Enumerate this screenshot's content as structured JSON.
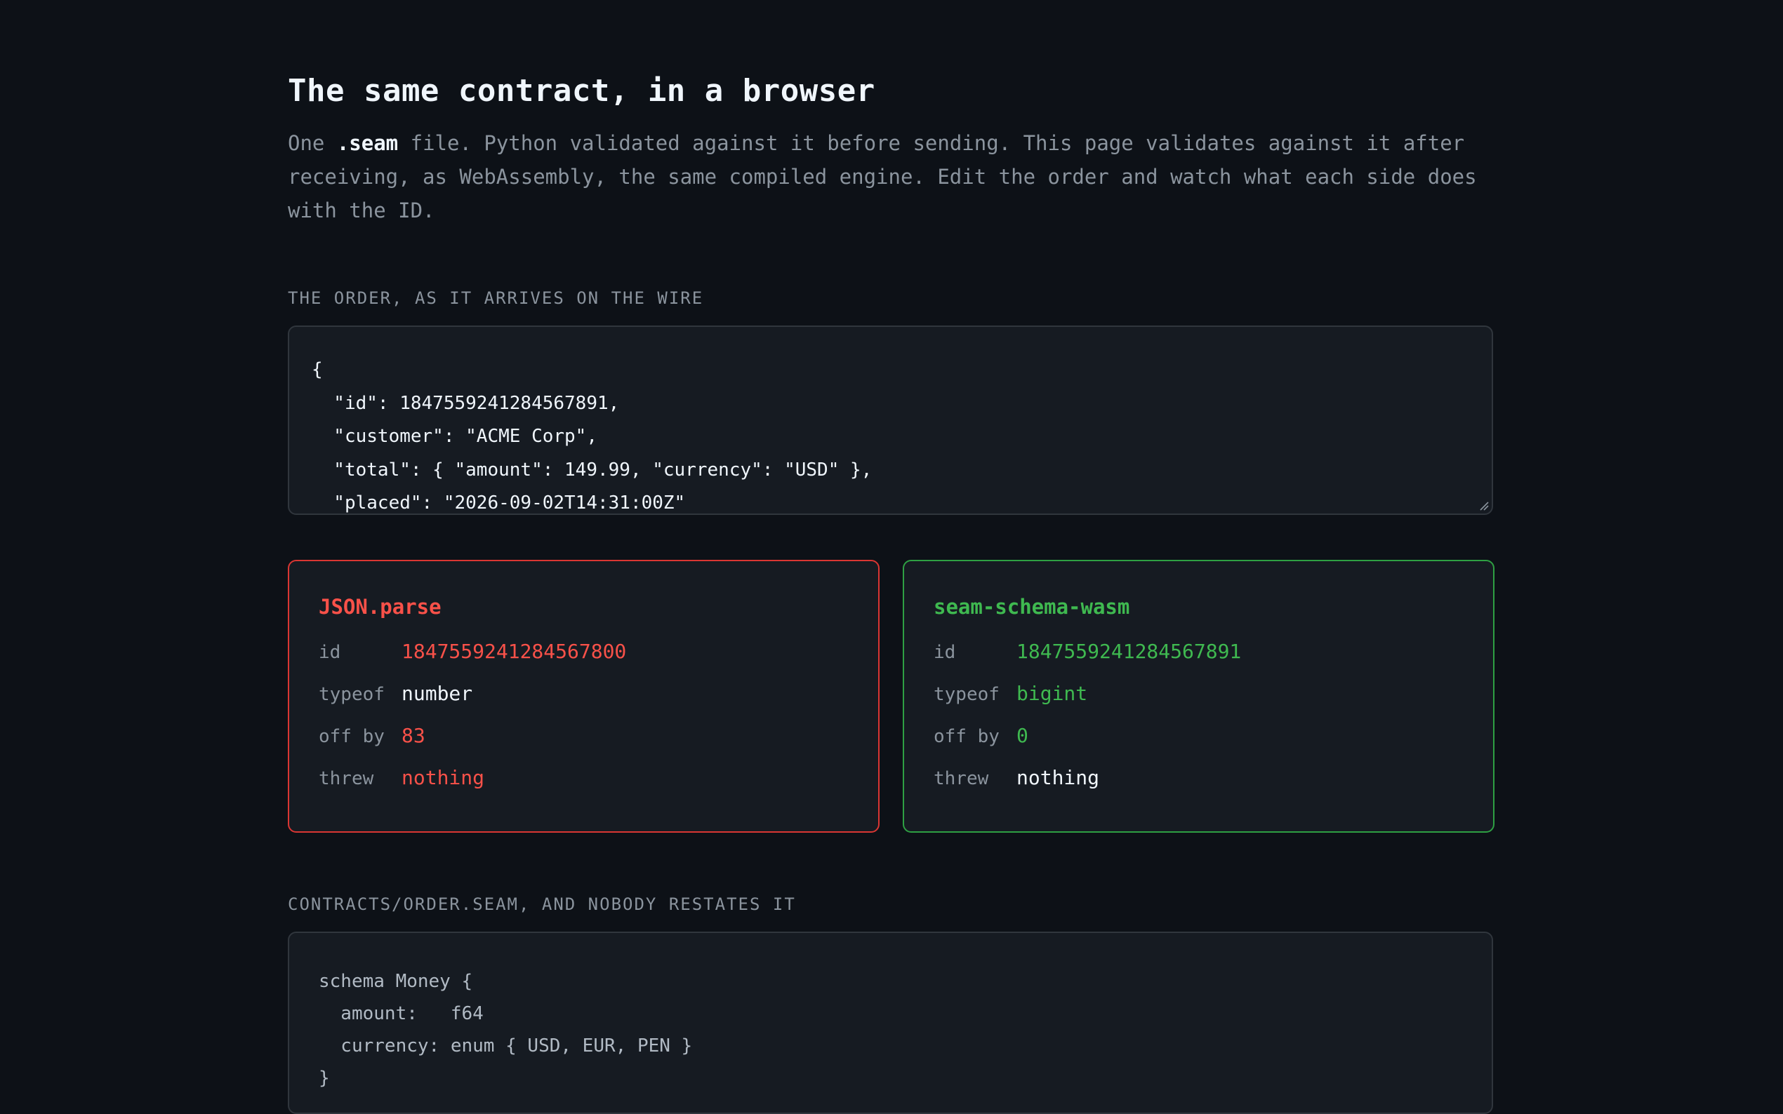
{
  "header": {
    "title": "The same contract, in a browser",
    "intro_pre": "One ",
    "intro_em": ".seam",
    "intro_post": " file. Python validated against it before sending. This page validates against it after receiving, as WebAssembly, the same compiled engine. Edit the order and watch what each side does with the ID."
  },
  "wire": {
    "label": "THE ORDER, AS IT ARRIVES ON THE WIRE",
    "lines": [
      "{",
      "  \"id\": 1847559241284567891,",
      "  \"customer\": \"ACME Corp\",",
      "  \"total\": { \"amount\": 149.99, \"currency\": \"USD\" },",
      "  \"placed\": \"2026-09-02T14:31:00Z\""
    ]
  },
  "json_parse": {
    "title": "JSON.parse",
    "rows": [
      {
        "key": "id",
        "value": "1847559241284567800"
      },
      {
        "key": "typeof",
        "value": "number"
      },
      {
        "key": "off by",
        "value": "83"
      },
      {
        "key": "threw",
        "value": "nothing"
      }
    ]
  },
  "seam_wasm": {
    "title": "seam-schema-wasm",
    "rows": [
      {
        "key": "id",
        "value": "1847559241284567891"
      },
      {
        "key": "typeof",
        "value": "bigint"
      },
      {
        "key": "off by",
        "value": "0"
      },
      {
        "key": "threw",
        "value": "nothing"
      }
    ]
  },
  "schema": {
    "label": "CONTRACTS/ORDER.SEAM, AND NOBODY RESTATES IT",
    "lines": [
      "schema Money {",
      "  amount:   f64",
      "  currency: enum { USD, EUR, PEN }",
      "}"
    ]
  },
  "colors": {
    "background": "#0d1117",
    "panel": "#161b22",
    "error": "#f85149",
    "success": "#3fb950"
  }
}
